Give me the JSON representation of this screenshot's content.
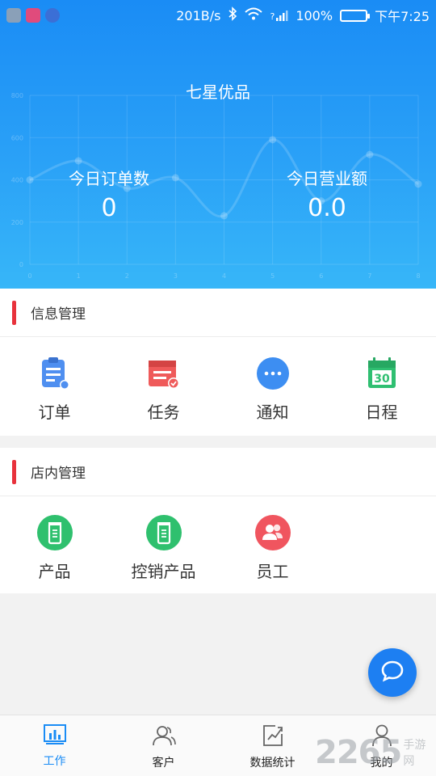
{
  "status_bar": {
    "speed": "201B/s",
    "network": "?",
    "battery": "100%",
    "time": "下午7:25"
  },
  "header": {
    "title": "七星优品",
    "today_orders_label": "今日订单数",
    "today_orders_value": "0",
    "today_revenue_label": "今日营业额",
    "today_revenue_value": "0.0"
  },
  "chart_data": {
    "type": "line",
    "x": [
      0,
      1,
      2,
      3,
      4,
      5,
      6,
      7,
      8
    ],
    "values": [
      400,
      490,
      360,
      410,
      230,
      590,
      300,
      520,
      380
    ],
    "xlim": [
      0,
      8
    ],
    "ylim": [
      0,
      800
    ],
    "y_ticks": [
      "0",
      "200",
      "400",
      "600",
      "800"
    ],
    "x_ticks": [
      "0",
      "1",
      "2",
      "3",
      "4",
      "5",
      "6",
      "7",
      "8"
    ],
    "grid": true
  },
  "info_section": {
    "title": "信息管理",
    "items": [
      {
        "label": "订单",
        "icon": "clipboard-icon"
      },
      {
        "label": "任务",
        "icon": "task-icon"
      },
      {
        "label": "通知",
        "icon": "chat-bubble-icon"
      },
      {
        "label": "日程",
        "icon": "calendar-icon",
        "badge": "30"
      }
    ]
  },
  "store_section": {
    "title": "店内管理",
    "items": [
      {
        "label": "产品",
        "icon": "bottle-icon"
      },
      {
        "label": "控销产品",
        "icon": "bottle-icon"
      },
      {
        "label": "员工",
        "icon": "people-icon"
      }
    ]
  },
  "bottom_nav": {
    "tabs": [
      {
        "label": "工作",
        "icon": "chart-icon",
        "active": true
      },
      {
        "label": "客户",
        "icon": "customers-icon"
      },
      {
        "label": "数据统计",
        "icon": "stats-icon"
      },
      {
        "label": "我的",
        "icon": "user-icon"
      }
    ]
  },
  "watermark": {
    "big": "2265",
    "small": "手游网"
  },
  "colors": {
    "header_top": "#1a8cf5",
    "header_bottom": "#37b6f8",
    "section_mark": "#e8323c",
    "fab": "#1d7ff2",
    "active_tab": "#1a8cf5"
  }
}
